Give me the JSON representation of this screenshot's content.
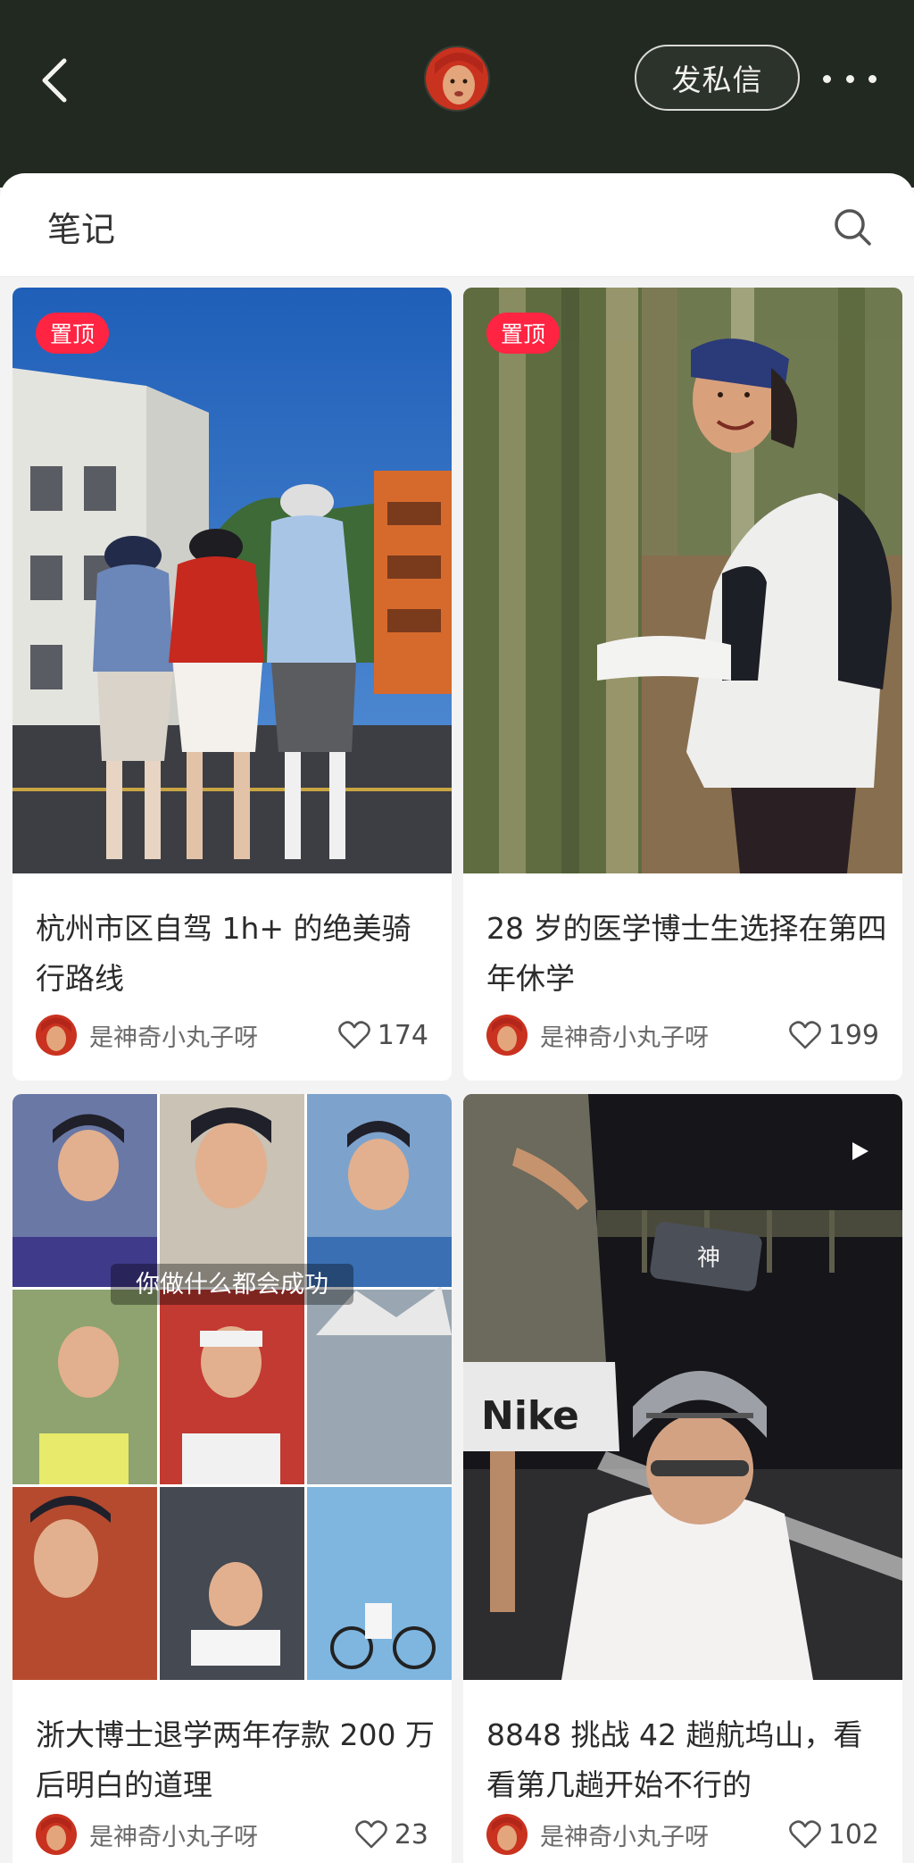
{
  "header": {
    "back_icon": "chevron-left-icon",
    "message_button": "发私信",
    "more_icon": "more-horizontal-icon"
  },
  "notes_section": {
    "title": "笔记",
    "search_icon": "search-icon"
  },
  "badge": {
    "pinned_label": "置顶",
    "color": "#ff2442"
  },
  "notes": [
    {
      "title": "杭州市区自驾 1h+ 的绝美骑行路线",
      "pinned": true,
      "author": "是神奇小丸子呀",
      "likes": "174"
    },
    {
      "title": "28 岁的医学博士生选择在第四年休学",
      "pinned": true,
      "author": "是神奇小丸子呀",
      "likes": "199"
    },
    {
      "title": "浙大博士退学两年存款 200 万后明白的道理",
      "pinned": false,
      "author": "是神奇小丸子呀",
      "likes": "23",
      "cover_caption": "你做什么都会成功"
    },
    {
      "title": "8848 挑战 42 趟航坞山，看看第几趟开始不行的",
      "pinned": false,
      "video": true,
      "author": "是神奇小丸子呀",
      "likes": "102",
      "cover_caption": "神"
    }
  ]
}
